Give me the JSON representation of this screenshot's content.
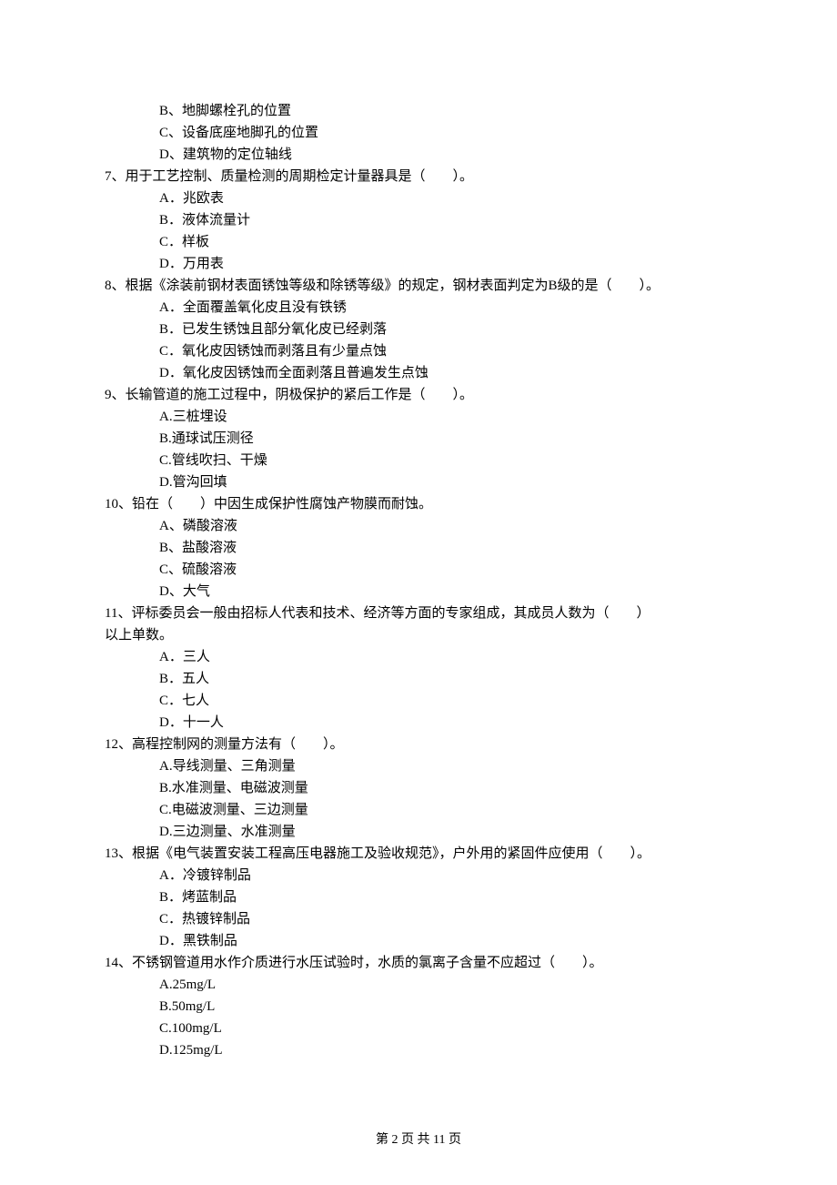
{
  "q6": {
    "opts": {
      "B": "B、地脚螺栓孔的位置",
      "C": "C、设备底座地脚孔的位置",
      "D": "D、建筑物的定位轴线"
    }
  },
  "q7": {
    "text": "7、用于工艺控制、质量检测的周期检定计量器具是（　　）。",
    "opts": {
      "A": "A．兆欧表",
      "B": "B．液体流量计",
      "C": "C．样板",
      "D": "D．万用表"
    }
  },
  "q8": {
    "text": "8、根据《涂装前钢材表面锈蚀等级和除锈等级》的规定，钢材表面判定为B级的是（　　）。",
    "opts": {
      "A": "A．全面覆盖氧化皮且没有铁锈",
      "B": "B．已发生锈蚀且部分氧化皮已经剥落",
      "C": "C．氧化皮因锈蚀而剥落且有少量点蚀",
      "D": "D．氧化皮因锈蚀而全面剥落且普遍发生点蚀"
    }
  },
  "q9": {
    "text": "9、长输管道的施工过程中，阴极保护的紧后工作是（　　）。",
    "opts": {
      "A": "A.三桩埋设",
      "B": "B.通球试压测径",
      "C": "C.管线吹扫、干燥",
      "D": "D.管沟回填"
    }
  },
  "q10": {
    "text": "10、铅在（　　）中因生成保护性腐蚀产物膜而耐蚀。",
    "opts": {
      "A": "A、磷酸溶液",
      "B": "B、盐酸溶液",
      "C": "C、硫酸溶液",
      "D": "D、大气"
    }
  },
  "q11": {
    "text_l1": "11、评标委员会一般由招标人代表和技术、经济等方面的专家组成，其成员人数为（　　）",
    "text_l2": "以上单数。",
    "opts": {
      "A": "A．三人",
      "B": "B．五人",
      "C": "C．七人",
      "D": "D．十一人"
    }
  },
  "q12": {
    "text": "12、高程控制网的测量方法有（　　）。",
    "opts": {
      "A": "A.导线测量、三角测量",
      "B": "B.水准测量、电磁波测量",
      "C": "C.电磁波测量、三边测量",
      "D": "D.三边测量、水准测量"
    }
  },
  "q13": {
    "text": "13、根据《电气装置安装工程高压电器施工及验收规范》，户外用的紧固件应使用（　　）。",
    "opts": {
      "A": "A．冷镀锌制品",
      "B": "B．烤蓝制品",
      "C": "C．热镀锌制品",
      "D": "D．黑铁制品"
    }
  },
  "q14": {
    "text": "14、不锈钢管道用水作介质进行水压试验时，水质的氯离子含量不应超过（　　）。",
    "opts": {
      "A": "A.25mg/L",
      "B": "B.50mg/L",
      "C": "C.100mg/L",
      "D": "D.125mg/L"
    }
  },
  "footer": "第 2 页 共 11 页"
}
